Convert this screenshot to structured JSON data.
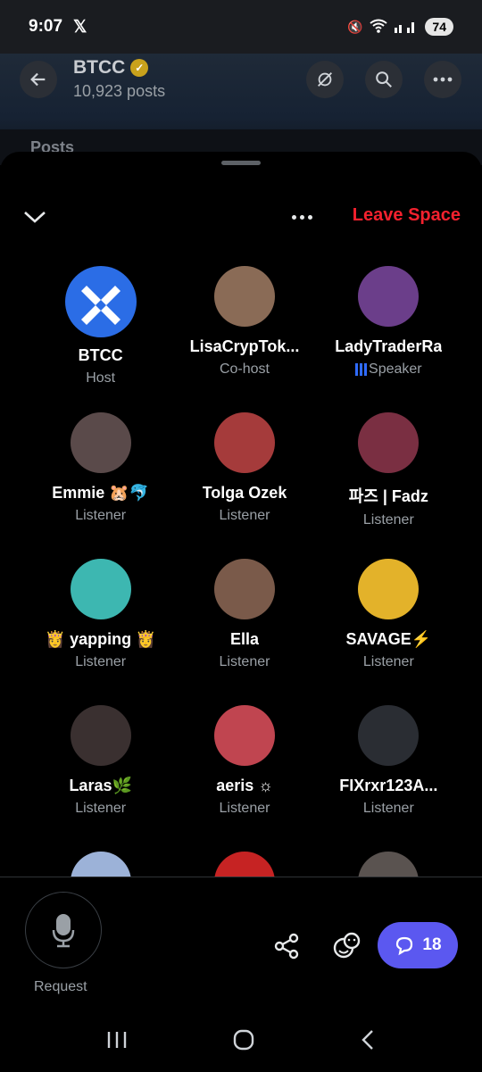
{
  "status": {
    "time": "9:07",
    "battery": "74"
  },
  "header": {
    "title": "BTCC",
    "posts": "10,923 posts",
    "tab_posts": "Posts"
  },
  "space": {
    "leave_label": "Leave Space"
  },
  "participants": [
    {
      "name": "BTCC",
      "role": "Host",
      "color": "#2b6de6"
    },
    {
      "name": "LisaCrypTok...",
      "role": "Co-host",
      "color": "#8a6b56"
    },
    {
      "name": "LadyTraderRa",
      "role": "Speaker",
      "color": "#6b3e8a"
    },
    {
      "name": "Emmie 🐹🐬",
      "role": "Listener",
      "color": "#5a4a4a"
    },
    {
      "name": "Tolga Ozek",
      "role": "Listener",
      "color": "#a53b3b"
    },
    {
      "name": "파즈 | Fadz",
      "role": "Listener",
      "color": "#7a2f42"
    },
    {
      "name": "👸 yapping 👸",
      "role": "Listener",
      "color": "#3db7b1"
    },
    {
      "name": "Ella",
      "role": "Listener",
      "color": "#7a5a4a"
    },
    {
      "name": "SAVAGE⚡",
      "role": "Listener",
      "color": "#e3b22a"
    },
    {
      "name": "Laras🌿",
      "role": "Listener",
      "color": "#3a3030"
    },
    {
      "name": "aeris ☼",
      "role": "Listener",
      "color": "#c04550"
    },
    {
      "name": "FIXrxr123A...",
      "role": "Listener",
      "color": "#2a2d33"
    },
    {
      "name": "",
      "role": "",
      "color": "#9cb2d8"
    },
    {
      "name": "",
      "role": "",
      "color": "#c62323"
    },
    {
      "name": "",
      "role": "",
      "color": "#5a5350"
    }
  ],
  "bottom": {
    "request_label": "Request",
    "comment_count": "18"
  }
}
